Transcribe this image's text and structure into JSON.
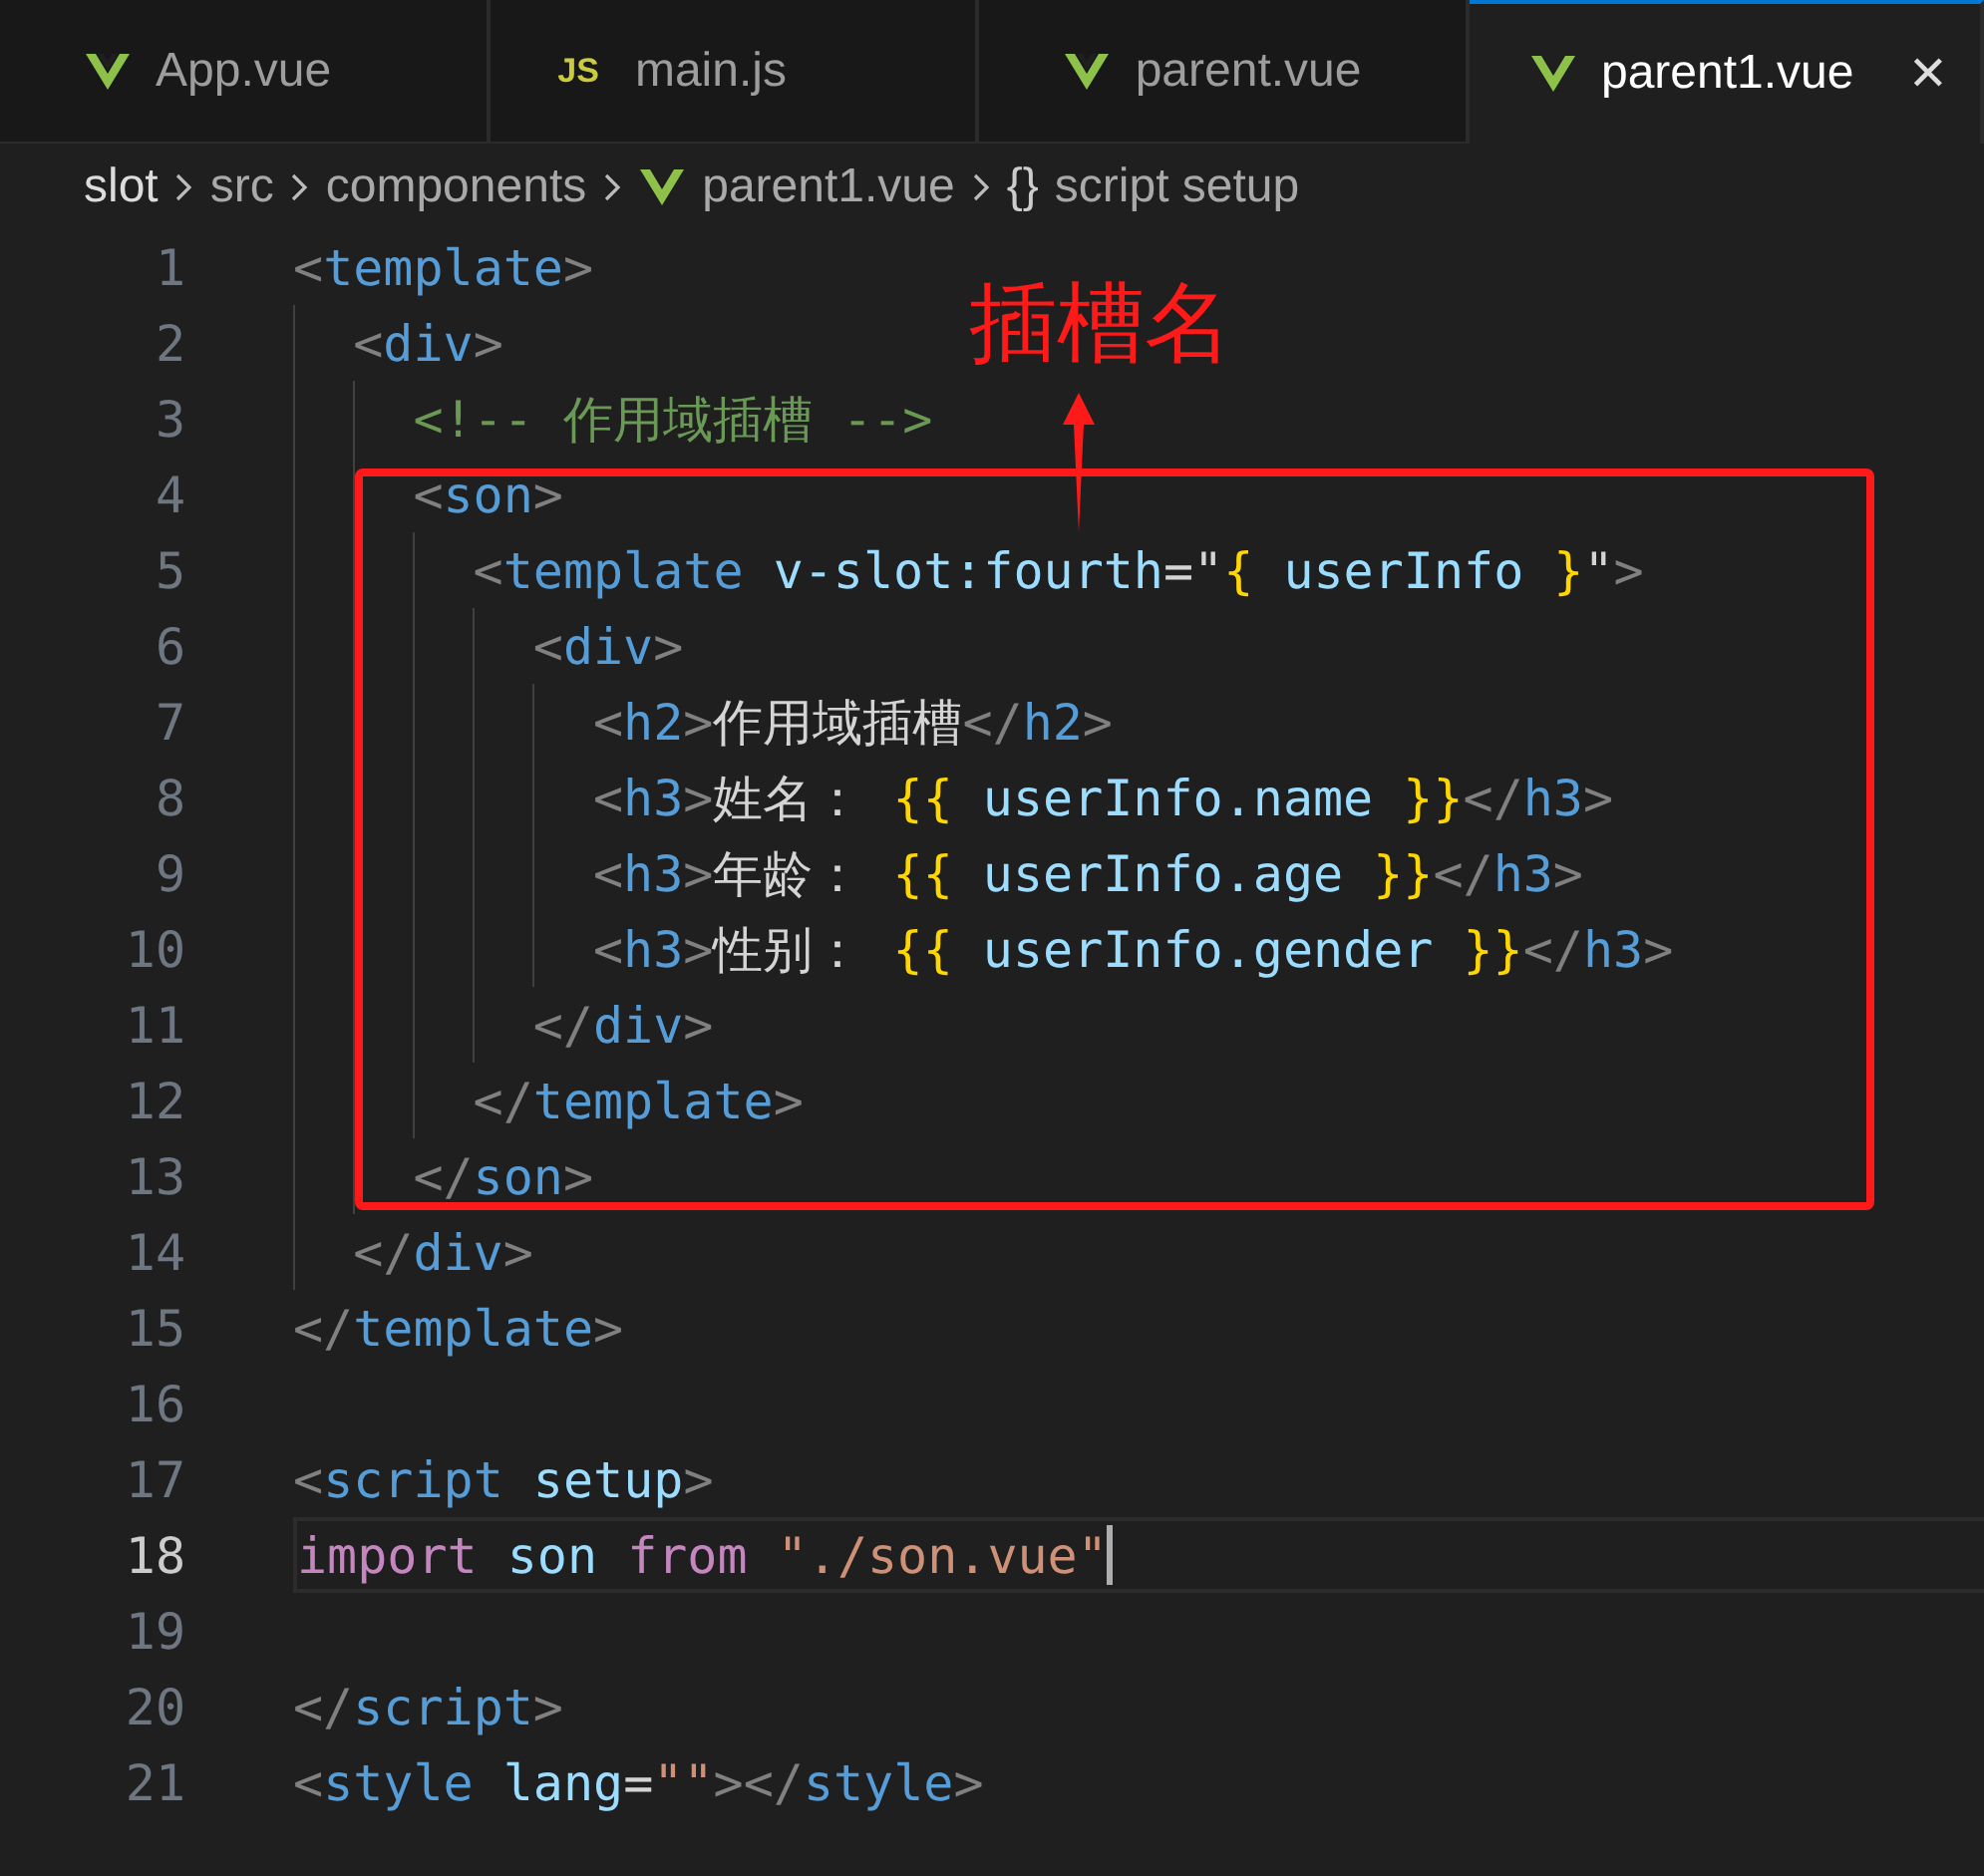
{
  "tabs": [
    {
      "label": "App.vue",
      "kind": "vue",
      "selected": false
    },
    {
      "label": "main.js",
      "kind": "js",
      "icon_text": "JS",
      "selected": false
    },
    {
      "label": "parent.vue",
      "kind": "vue",
      "selected": false
    },
    {
      "label": "parent1.vue",
      "kind": "vue",
      "selected": true,
      "close": "✕"
    }
  ],
  "breadcrumb": [
    {
      "label": "slot",
      "kind": "plain"
    },
    {
      "label": "src",
      "kind": "plain"
    },
    {
      "label": "components",
      "kind": "plain"
    },
    {
      "label": "parent1.vue",
      "kind": "vue"
    },
    {
      "label": "script setup",
      "kind": "symbol",
      "icon_text": "{}"
    }
  ],
  "code": [
    {
      "number": "1",
      "tokens": [
        {
          "t": "<",
          "kind": "punct"
        },
        {
          "t": "template",
          "kind": "tag"
        },
        {
          "t": ">",
          "kind": "punct"
        }
      ],
      "children": [
        {
          "number": "2",
          "tokens": [
            {
              "t": "<",
              "kind": "punct"
            },
            {
              "t": "div",
              "kind": "tag"
            },
            {
              "t": ">",
              "kind": "punct"
            }
          ],
          "children": [
            {
              "number": "3",
              "tokens": [
                {
                  "t": "<!-- 作用域插槽 -->",
                  "kind": "comment"
                }
              ]
            },
            {
              "number": "4",
              "tokens": [
                {
                  "t": "<",
                  "kind": "punct"
                },
                {
                  "t": "son",
                  "kind": "tag"
                },
                {
                  "t": ">",
                  "kind": "punct"
                }
              ],
              "children": [
                {
                  "number": "5",
                  "tokens": [
                    {
                      "t": "<",
                      "kind": "punct"
                    },
                    {
                      "t": "template",
                      "kind": "tag"
                    },
                    {
                      "t": " v-slot:fourth",
                      "kind": "attr"
                    },
                    {
                      "t": "=\"",
                      "kind": "text"
                    },
                    {
                      "t": "{",
                      "kind": "brace"
                    },
                    {
                      "t": " userInfo ",
                      "kind": "attr"
                    },
                    {
                      "t": "}",
                      "kind": "brace"
                    },
                    {
                      "t": "\"",
                      "kind": "text"
                    },
                    {
                      "t": ">",
                      "kind": "punct"
                    }
                  ],
                  "children": [
                    {
                      "number": "6",
                      "tokens": [
                        {
                          "t": "<",
                          "kind": "punct"
                        },
                        {
                          "t": "div",
                          "kind": "tag"
                        },
                        {
                          "t": ">",
                          "kind": "punct"
                        }
                      ],
                      "children": [
                        {
                          "number": "7",
                          "tokens": [
                            {
                              "t": "<",
                              "kind": "punct"
                            },
                            {
                              "t": "h2",
                              "kind": "tag"
                            },
                            {
                              "t": ">",
                              "kind": "punct"
                            },
                            {
                              "t": "作用域插槽",
                              "kind": "text"
                            },
                            {
                              "t": "</",
                              "kind": "punct"
                            },
                            {
                              "t": "h2",
                              "kind": "tag"
                            },
                            {
                              "t": ">",
                              "kind": "punct"
                            }
                          ]
                        },
                        {
                          "number": "8",
                          "tokens": [
                            {
                              "t": "<",
                              "kind": "punct"
                            },
                            {
                              "t": "h3",
                              "kind": "tag"
                            },
                            {
                              "t": ">",
                              "kind": "punct"
                            },
                            {
                              "t": "姓名： ",
                              "kind": "text"
                            },
                            {
                              "t": "{{",
                              "kind": "brace"
                            },
                            {
                              "t": " userInfo.name ",
                              "kind": "attr"
                            },
                            {
                              "t": "}}",
                              "kind": "brace"
                            },
                            {
                              "t": "</",
                              "kind": "punct"
                            },
                            {
                              "t": "h3",
                              "kind": "tag"
                            },
                            {
                              "t": ">",
                              "kind": "punct"
                            }
                          ]
                        },
                        {
                          "number": "9",
                          "tokens": [
                            {
                              "t": "<",
                              "kind": "punct"
                            },
                            {
                              "t": "h3",
                              "kind": "tag"
                            },
                            {
                              "t": ">",
                              "kind": "punct"
                            },
                            {
                              "t": "年龄： ",
                              "kind": "text"
                            },
                            {
                              "t": "{{",
                              "kind": "brace"
                            },
                            {
                              "t": " userInfo.age ",
                              "kind": "attr"
                            },
                            {
                              "t": "}}",
                              "kind": "brace"
                            },
                            {
                              "t": "</",
                              "kind": "punct"
                            },
                            {
                              "t": "h3",
                              "kind": "tag"
                            },
                            {
                              "t": ">",
                              "kind": "punct"
                            }
                          ]
                        },
                        {
                          "number": "10",
                          "tokens": [
                            {
                              "t": "<",
                              "kind": "punct"
                            },
                            {
                              "t": "h3",
                              "kind": "tag"
                            },
                            {
                              "t": ">",
                              "kind": "punct"
                            },
                            {
                              "t": "性别： ",
                              "kind": "text"
                            },
                            {
                              "t": "{{",
                              "kind": "brace"
                            },
                            {
                              "t": " userInfo.gender ",
                              "kind": "attr"
                            },
                            {
                              "t": "}}",
                              "kind": "brace"
                            },
                            {
                              "t": "</",
                              "kind": "punct"
                            },
                            {
                              "t": "h3",
                              "kind": "tag"
                            },
                            {
                              "t": ">",
                              "kind": "punct"
                            }
                          ]
                        }
                      ]
                    },
                    {
                      "number": "11",
                      "tokens": [
                        {
                          "t": "</",
                          "kind": "punct"
                        },
                        {
                          "t": "div",
                          "kind": "tag"
                        },
                        {
                          "t": ">",
                          "kind": "punct"
                        }
                      ]
                    }
                  ]
                },
                {
                  "number": "12",
                  "tokens": [
                    {
                      "t": "</",
                      "kind": "punct"
                    },
                    {
                      "t": "template",
                      "kind": "tag"
                    },
                    {
                      "t": ">",
                      "kind": "punct"
                    }
                  ]
                }
              ]
            },
            {
              "number": "13",
              "tokens": [
                {
                  "t": "</",
                  "kind": "punct"
                },
                {
                  "t": "son",
                  "kind": "tag"
                },
                {
                  "t": ">",
                  "kind": "punct"
                }
              ]
            }
          ]
        },
        {
          "number": "14",
          "tokens": [
            {
              "t": "</",
              "kind": "punct"
            },
            {
              "t": "div",
              "kind": "tag"
            },
            {
              "t": ">",
              "kind": "punct"
            }
          ]
        }
      ]
    },
    {
      "number": "15",
      "tokens": [
        {
          "t": "</",
          "kind": "punct"
        },
        {
          "t": "template",
          "kind": "tag"
        },
        {
          "t": ">",
          "kind": "punct"
        }
      ]
    },
    {
      "number": "16"
    },
    {
      "number": "17",
      "tokens": [
        {
          "t": "<",
          "kind": "punct"
        },
        {
          "t": "script",
          "kind": "tag"
        },
        {
          "t": " setup",
          "kind": "attr"
        },
        {
          "t": ">",
          "kind": "punct"
        }
      ]
    },
    {
      "number": "18",
      "current": true,
      "tokens": [
        {
          "t": "import",
          "kind": "keyword"
        },
        {
          "t": " son ",
          "kind": "attr"
        },
        {
          "t": "from",
          "kind": "keyword"
        },
        {
          "t": " \"./son.vue\"",
          "kind": "string"
        }
      ]
    },
    {
      "number": "19"
    },
    {
      "number": "20",
      "tokens": [
        {
          "t": "</",
          "kind": "punct"
        },
        {
          "t": "script",
          "kind": "tag"
        },
        {
          "t": ">",
          "kind": "punct"
        }
      ]
    },
    {
      "number": "21",
      "tokens": [
        {
          "t": "<",
          "kind": "punct"
        },
        {
          "t": "style",
          "kind": "tag"
        },
        {
          "t": " lang",
          "kind": "attr"
        },
        {
          "t": "=",
          "kind": "text"
        },
        {
          "t": "\"\"",
          "kind": "string"
        },
        {
          "t": ">",
          "kind": "punct"
        },
        {
          "t": "</",
          "kind": "punct"
        },
        {
          "t": "style",
          "kind": "tag"
        },
        {
          "t": ">",
          "kind": "punct"
        }
      ]
    }
  ],
  "annotation": {
    "label": "插槽名"
  }
}
